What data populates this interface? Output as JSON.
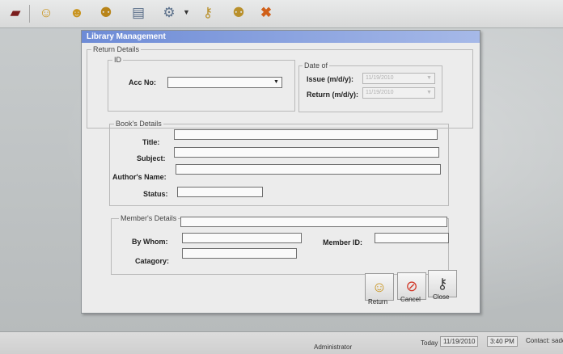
{
  "window": {
    "title": "Library Management"
  },
  "toolbar": {
    "icons": [
      "book-icon",
      "user-icon",
      "user-add-icon",
      "users-icon",
      "report-icon",
      "tools-dropdown-icon",
      "key-icon",
      "search-user-icon",
      "exit-icon"
    ]
  },
  "return_details": {
    "legend": "Return Details",
    "id_group": {
      "legend": "ID",
      "acc_no_label": "Acc No:",
      "acc_no_value": ""
    },
    "date_group": {
      "legend": "Date of",
      "issue_label": "Issue (m/d/y):",
      "issue_value": "11/19/2010",
      "return_label": "Return (m/d/y):",
      "return_value": "11/19/2010"
    }
  },
  "books": {
    "legend": "Book's Details",
    "title_label": "Title:",
    "subject_label": "Subject:",
    "author_label": "Author's Name:",
    "status_label": "Status:"
  },
  "members": {
    "legend": "Member's Details",
    "by_whom_label": "By Whom:",
    "member_id_label": "Member ID:",
    "category_label": "Catagory:"
  },
  "buttons": {
    "return": "Return",
    "cancel": "Cancel",
    "close": "Close"
  },
  "statusbar": {
    "user": "Administrator",
    "today_label": "Today",
    "date": "11/19/2010",
    "time": "3:40 PM",
    "contact_label": "Contact:",
    "contact_value": "sadc"
  }
}
